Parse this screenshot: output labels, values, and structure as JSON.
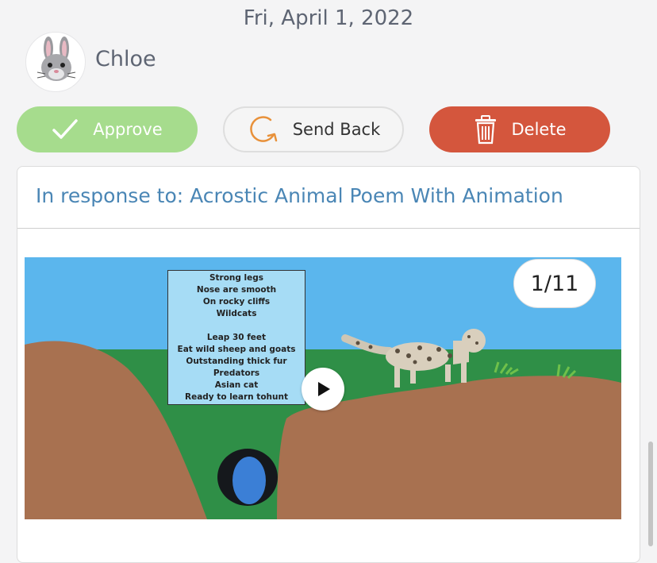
{
  "header": {
    "date": "Fri, April 1, 2022"
  },
  "student": {
    "name": "Chloe",
    "avatar_icon": "rabbit-face-icon"
  },
  "actions": {
    "approve_label": "Approve",
    "send_back_label": "Send Back",
    "delete_label": "Delete"
  },
  "colors": {
    "approve": "#a6dc8d",
    "delete": "#d4563d",
    "link": "#4a86b5",
    "send_back_icon": "#e8913a"
  },
  "post": {
    "title": "In response to: Acrostic Animal Poem With Animation",
    "slide_counter": "1/11",
    "poem_lines": [
      "Strong legs",
      "Nose are smooth",
      "On rocky cliffs",
      "Wildcats",
      "",
      "Leap 30 feet",
      "Eat wild sheep and goats",
      "Outstanding thick fur",
      "Predators",
      "Asian cat",
      "Ready to learn tohunt"
    ]
  }
}
